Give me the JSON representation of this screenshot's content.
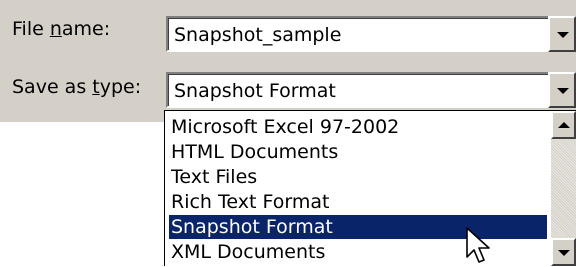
{
  "file_name": {
    "label_prefix": "File ",
    "label_mnemonic": "n",
    "label_suffix": "ame:",
    "value": "Snapshot_sample"
  },
  "save_as_type": {
    "label_prefix": "Save as ",
    "label_mnemonic": "t",
    "label_suffix": "ype:",
    "value": "Snapshot Format"
  },
  "type_list": {
    "items": [
      {
        "label": "Microsoft Excel 97-2002",
        "selected": false
      },
      {
        "label": "HTML Documents",
        "selected": false
      },
      {
        "label": "Text Files",
        "selected": false
      },
      {
        "label": "Rich Text Format",
        "selected": false
      },
      {
        "label": "Snapshot Format",
        "selected": true
      },
      {
        "label": "XML Documents",
        "selected": false
      }
    ]
  },
  "colors": {
    "dialog_background": "#d4d0c8",
    "selection_background": "#0a246a",
    "selection_text": "#ffffff"
  },
  "icons": {
    "dropdown": "chevron-down-icon",
    "scroll_up": "arrow-up-icon",
    "scroll_down": "arrow-down-icon",
    "cursor": "mouse-pointer-icon"
  }
}
